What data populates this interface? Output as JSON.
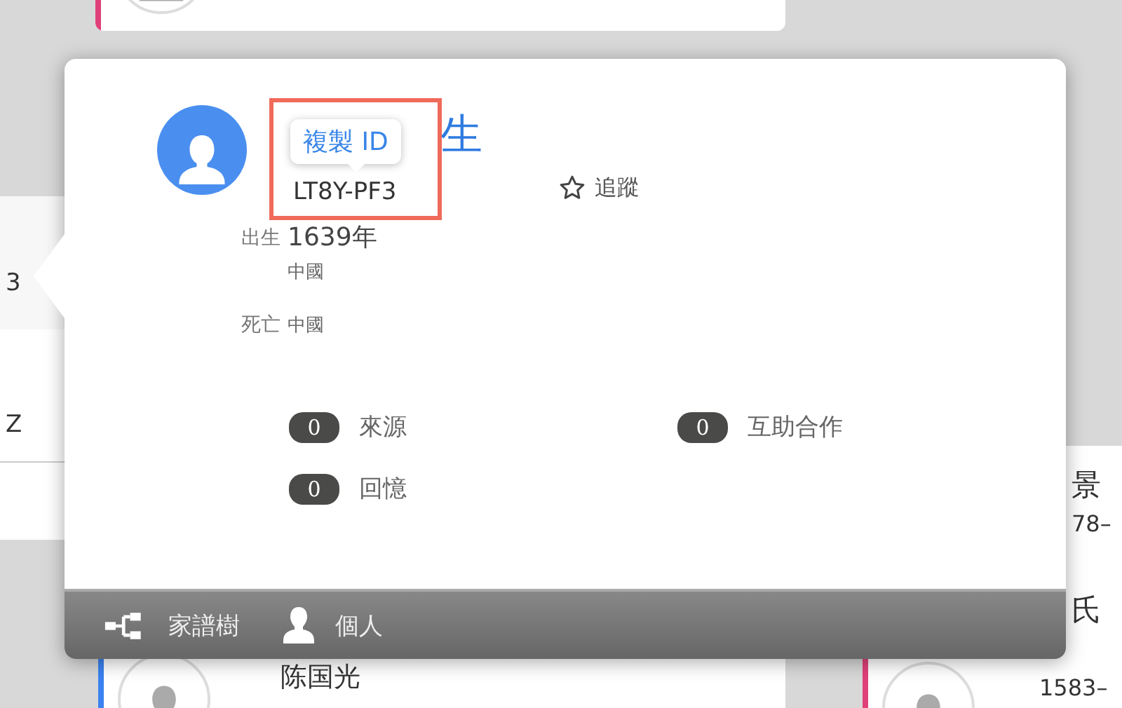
{
  "tree_cards": [
    {
      "kind": "top",
      "color": "#e0407a"
    },
    {
      "kind": "left-upper",
      "lines": [
        "3"
      ]
    },
    {
      "kind": "left-lower",
      "lines": [
        "Z"
      ]
    },
    {
      "kind": "bottom",
      "color": "#3b82f0",
      "lines": [
        "陈国光"
      ]
    },
    {
      "kind": "right",
      "color": "#e0407a",
      "lines": [
        "景",
        "78–",
        "氏",
        "1583–"
      ]
    }
  ],
  "person_popup": {
    "name": "生",
    "id": "LT8Y-PF3",
    "copy_tooltip": "複製 ID",
    "follow": {
      "label": "追蹤"
    },
    "facts": [
      {
        "label": "出生",
        "value": "1639年",
        "place": "中國"
      },
      {
        "label": "死亡",
        "place": "中國"
      }
    ],
    "counts": [
      {
        "count": "0",
        "label": "來源"
      },
      {
        "count": "0",
        "label": "互助合作"
      },
      {
        "count": "0",
        "label": "回憶"
      }
    ],
    "footer_tabs": [
      {
        "kind": "tree",
        "label": "家譜樹"
      },
      {
        "kind": "person",
        "label": "個人"
      }
    ]
  }
}
